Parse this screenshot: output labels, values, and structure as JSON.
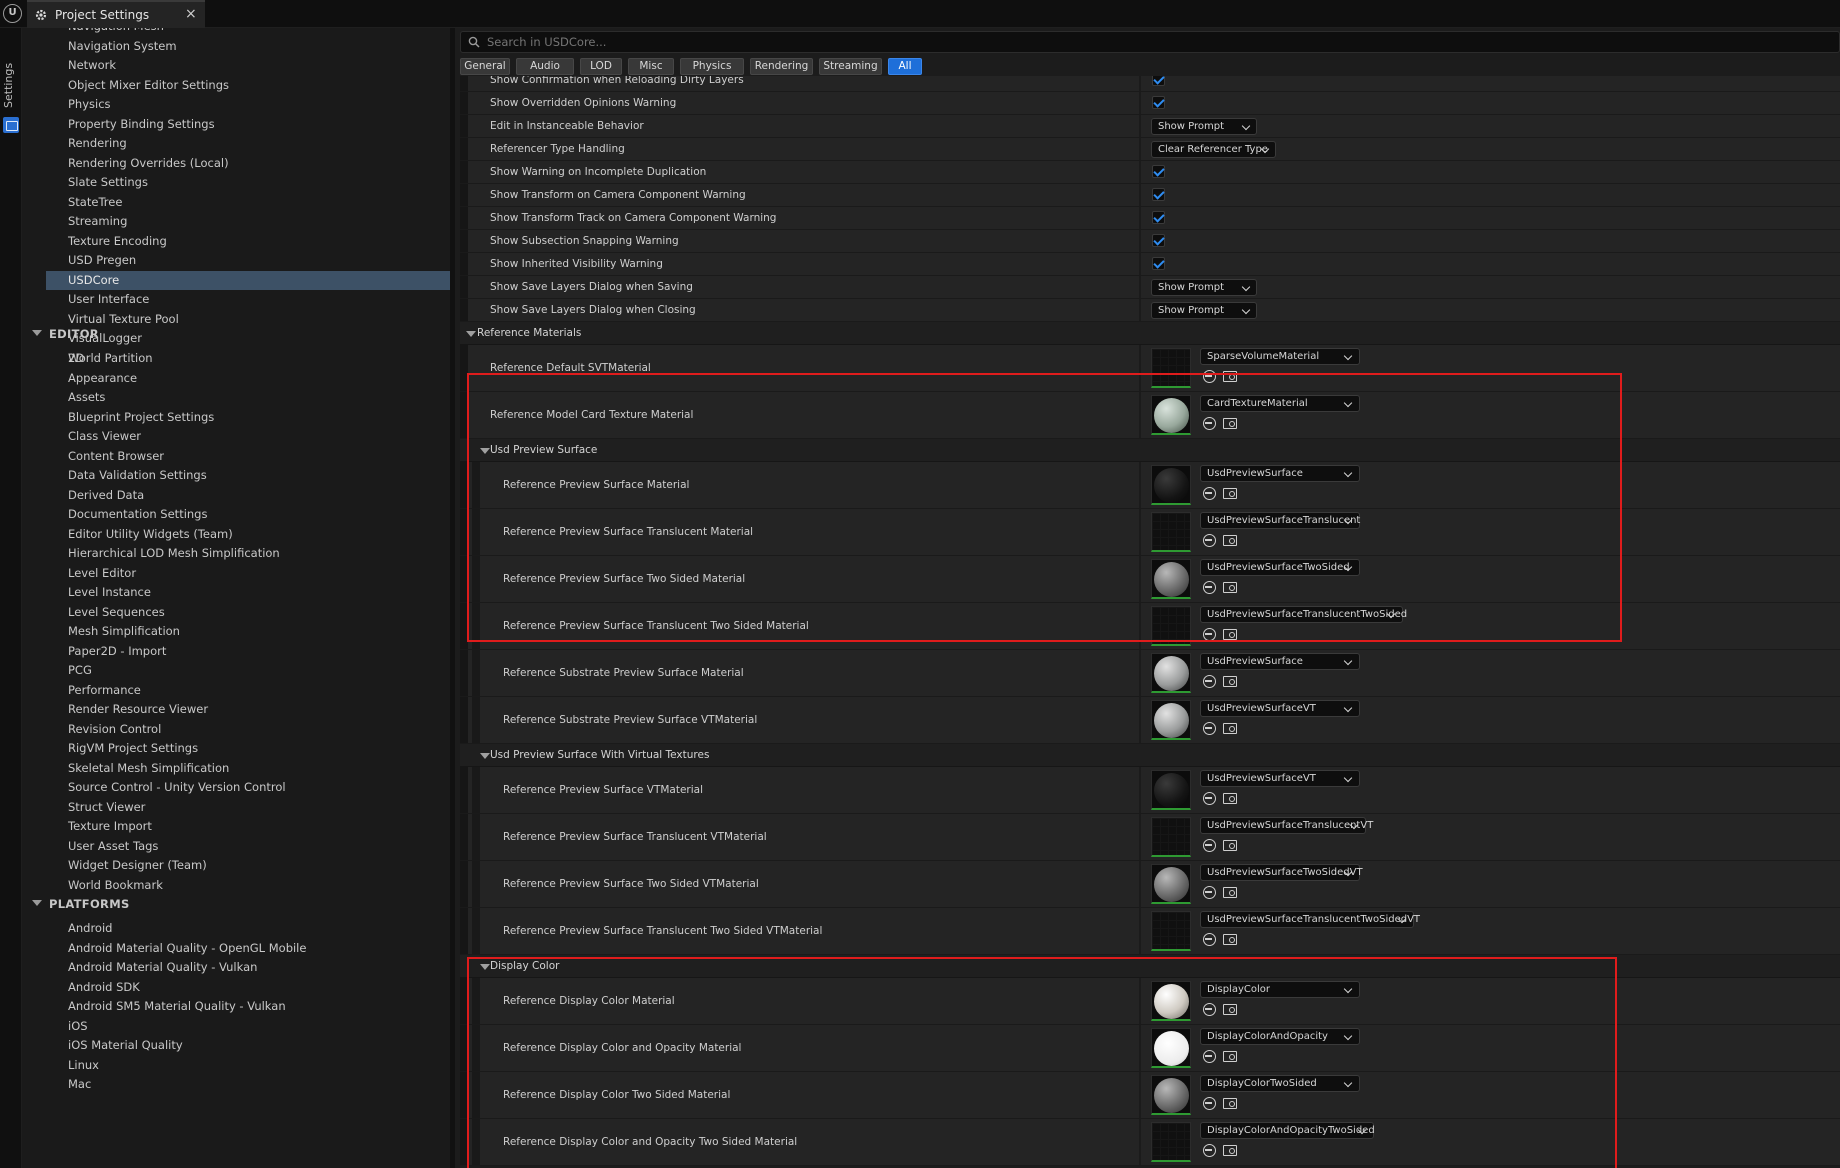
{
  "window": {
    "tab_title": "Project Settings",
    "close_glyph": "×",
    "logo_glyph": "U"
  },
  "left_strip": {
    "label": "Settings"
  },
  "sidebar": {
    "items_top": [
      "Navigation Mesh",
      "Navigation System",
      "Network",
      "Object Mixer Editor Settings",
      "Physics",
      "Property Binding Settings",
      "Rendering",
      "Rendering Overrides (Local)",
      "Slate Settings",
      "StateTree",
      "Streaming",
      "Texture Encoding",
      "USD Pregen",
      "USDCore",
      "User Interface",
      "Virtual Texture Pool",
      "VisualLogger",
      "World Partition"
    ],
    "selected": "USDCore",
    "editor_header": "EDITOR",
    "editor_items": [
      "2D",
      "Appearance",
      "Assets",
      "Blueprint Project Settings",
      "Class Viewer",
      "Content Browser",
      "Data Validation Settings",
      "Derived Data",
      "Documentation Settings",
      "Editor Utility Widgets (Team)",
      "Hierarchical LOD Mesh Simplification",
      "Level Editor",
      "Level Instance",
      "Level Sequences",
      "Mesh Simplification",
      "Paper2D - Import",
      "PCG",
      "Performance",
      "Render Resource Viewer",
      "Revision Control",
      "RigVM Project Settings",
      "Skeletal Mesh Simplification",
      "Source Control - Unity Version Control",
      "Struct Viewer",
      "Texture Import",
      "User Asset Tags",
      "Widget Designer (Team)",
      "World Bookmark"
    ],
    "platforms_header": "PLATFORMS",
    "platform_items": [
      "Android",
      "Android Material Quality - OpenGL Mobile",
      "Android Material Quality - Vulkan",
      "Android SDK",
      "Android SM5 Material Quality - Vulkan",
      "iOS",
      "iOS Material Quality",
      "Linux",
      "Mac"
    ]
  },
  "search": {
    "placeholder": "Search in USDCore..."
  },
  "categories": [
    {
      "label": "General"
    },
    {
      "label": "Audio"
    },
    {
      "label": "LOD"
    },
    {
      "label": "Misc"
    },
    {
      "label": "Physics"
    },
    {
      "label": "Rendering"
    },
    {
      "label": "Streaming"
    },
    {
      "label": "All",
      "active": true
    }
  ],
  "properties": [
    {
      "label": "Show Confirmation when Reloading Dirty Layers",
      "type": "check",
      "value": true
    },
    {
      "label": "Show Overridden Opinions Warning",
      "type": "check",
      "value": true
    },
    {
      "label": "Edit in Instanceable Behavior",
      "type": "combo",
      "value": "Show Prompt"
    },
    {
      "label": "Referencer Type Handling",
      "type": "combo",
      "value": "Clear Referencer Type"
    },
    {
      "label": "Show Warning on Incomplete Duplication",
      "type": "check",
      "value": true
    },
    {
      "label": "Show Transform on Camera Component Warning",
      "type": "check",
      "value": true
    },
    {
      "label": "Show Transform Track on Camera Component Warning",
      "type": "check",
      "value": true
    },
    {
      "label": "Show Subsection Snapping Warning",
      "type": "check",
      "value": true
    },
    {
      "label": "Show Inherited Visibility Warning",
      "type": "check",
      "value": true
    },
    {
      "label": "Show Save Layers Dialog when Saving",
      "type": "combo",
      "value": "Show Prompt"
    },
    {
      "label": "Show Save Layers Dialog when Closing",
      "type": "combo",
      "value": "Show Prompt"
    }
  ],
  "reference_materials": {
    "title": "Reference Materials",
    "items": [
      {
        "label": "Reference Default SVTMaterial",
        "asset": "SparseVolumeMaterial",
        "thumb": "empty"
      },
      {
        "label": "Reference Model Card Texture Material",
        "asset": "CardTextureMaterial",
        "thumb": "marble"
      }
    ]
  },
  "usd_preview_surface": {
    "title": "Usd Preview Surface",
    "items": [
      {
        "label": "Reference Preview Surface Material",
        "asset": "UsdPreviewSurface",
        "thumb": "dark"
      },
      {
        "label": "Reference Preview Surface Translucent Material",
        "asset": "UsdPreviewSurfaceTranslucent",
        "thumb": "empty"
      },
      {
        "label": "Reference Preview Surface Two Sided Material",
        "asset": "UsdPreviewSurfaceTwoSided",
        "thumb": "grey"
      },
      {
        "label": "Reference Preview Surface Translucent Two Sided Material",
        "asset": "UsdPreviewSurfaceTranslucentTwoSided",
        "thumb": "empty"
      },
      {
        "label": "Reference Substrate Preview Surface Material",
        "asset": "UsdPreviewSurface",
        "thumb": "silver"
      },
      {
        "label": "Reference Substrate Preview Surface VTMaterial",
        "asset": "UsdPreviewSurfaceVT",
        "thumb": "silver"
      }
    ]
  },
  "usd_preview_surface_vt": {
    "title": "Usd Preview Surface With Virtual Textures",
    "items": [
      {
        "label": "Reference Preview Surface VTMaterial",
        "asset": "UsdPreviewSurfaceVT",
        "thumb": "dark"
      },
      {
        "label": "Reference Preview Surface Translucent VTMaterial",
        "asset": "UsdPreviewSurfaceTranslucentVT",
        "thumb": "empty"
      },
      {
        "label": "Reference Preview Surface Two Sided VTMaterial",
        "asset": "UsdPreviewSurfaceTwoSidedVT",
        "thumb": "grey"
      },
      {
        "label": "Reference Preview Surface Translucent Two Sided VTMaterial",
        "asset": "UsdPreviewSurfaceTranslucentTwoSidedVT",
        "thumb": "empty"
      }
    ]
  },
  "display_color": {
    "title": "Display Color",
    "items": [
      {
        "label": "Reference Display Color Material",
        "asset": "DisplayColor",
        "thumb": "light"
      },
      {
        "label": "Reference Display Color and Opacity Material",
        "asset": "DisplayColorAndOpacity",
        "thumb": "white"
      },
      {
        "label": "Reference Display Color Two Sided Material",
        "asset": "DisplayColorTwoSided",
        "thumb": "grey"
      },
      {
        "label": "Reference Display Color and Opacity Two Sided Material",
        "asset": "DisplayColorAndOpacityTwoSided",
        "thumb": "empty"
      }
    ]
  },
  "colors": {
    "accent": "#1e6fd9",
    "selection": "#3d5166",
    "highlight_box": "#e01c1c",
    "thumb_underline": "#2e9a32"
  }
}
